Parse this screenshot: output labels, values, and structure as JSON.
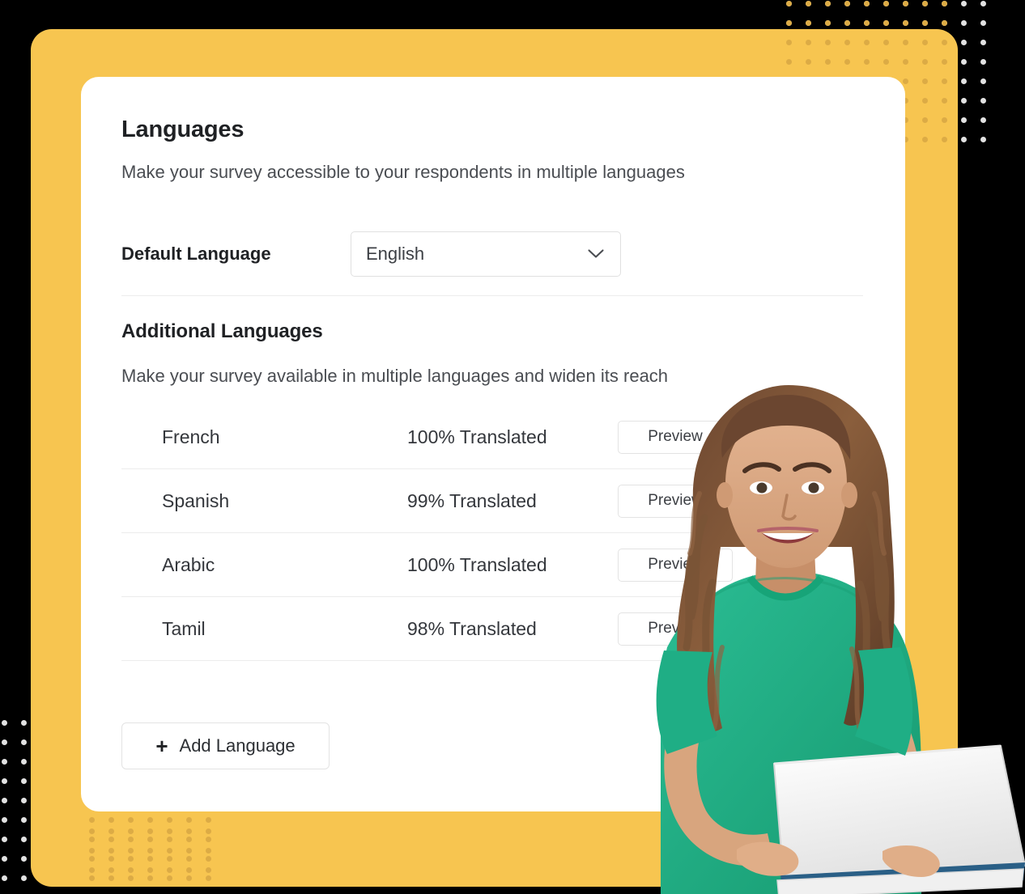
{
  "panel": {
    "title": "Languages",
    "subtitle": "Make your survey accessible to your respondents in multiple languages"
  },
  "default_language": {
    "label": "Default Language",
    "value": "English",
    "chevron_icon": "chevron-down-icon"
  },
  "additional": {
    "title": "Additional Languages",
    "subtitle": "Make your survey available in multiple languages and widen its reach",
    "rows": [
      {
        "language": "French",
        "progress": "100% Translated",
        "action": "Preview"
      },
      {
        "language": "Spanish",
        "progress": "99% Translated",
        "action": "Preview"
      },
      {
        "language": "Arabic",
        "progress": "100% Translated",
        "action": "Preview"
      },
      {
        "language": "Tamil",
        "progress": "98% Translated",
        "action": "Preview"
      }
    ]
  },
  "add_language": {
    "label": "Add Language",
    "icon": "plus-icon"
  },
  "decoration": {
    "photo_alt": "smiling-woman-holding-laptop",
    "dot_pattern": "dot-grid"
  },
  "colors": {
    "background": "#000000",
    "panel_yellow": "#f7c550",
    "card_white": "#ffffff",
    "dot_light": "#e2e2e2",
    "dot_on_yellow": "#dcab45",
    "text_primary": "#1f2124",
    "text_secondary": "#4a4d52",
    "border": "#e3e3e3",
    "shirt_green": "#23b08a"
  }
}
